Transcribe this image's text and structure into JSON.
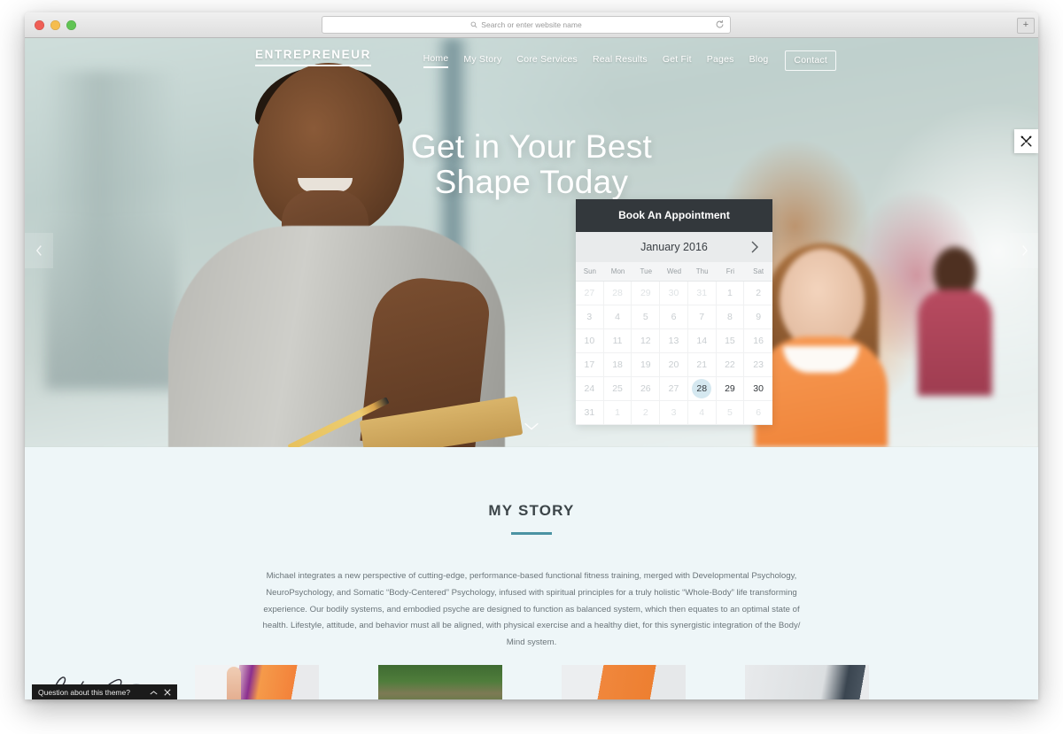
{
  "browser": {
    "address_placeholder": "Search or enter website name",
    "search_icon": "search-icon",
    "reload_icon": "reload-icon",
    "new_tab_label": "+",
    "traffic_lights": [
      "close",
      "minimize",
      "maximize"
    ]
  },
  "site": {
    "brand": "ENTREPRENEUR",
    "nav": [
      {
        "label": "Home",
        "active": true,
        "boxed": false
      },
      {
        "label": "My Story",
        "active": false,
        "boxed": false
      },
      {
        "label": "Core Services",
        "active": false,
        "boxed": false
      },
      {
        "label": "Real Results",
        "active": false,
        "boxed": false
      },
      {
        "label": "Get Fit",
        "active": false,
        "boxed": false
      },
      {
        "label": "Pages",
        "active": false,
        "boxed": false
      },
      {
        "label": "Blog",
        "active": false,
        "boxed": false
      },
      {
        "label": "Contact",
        "active": false,
        "boxed": true
      }
    ]
  },
  "hero": {
    "headline_line1": "Get in Your Best",
    "headline_line2": "Shape Today",
    "prev_arrow_icon": "chevron-left-icon",
    "next_arrow_icon": "chevron-right-icon",
    "scroll_icon": "chevron-down-icon"
  },
  "appointment": {
    "title": "Book An Appointment",
    "month": "January 2016",
    "next_month_icon": "chevron-right-icon",
    "weekdays": [
      "Sun",
      "Mon",
      "Tue",
      "Wed",
      "Thu",
      "Fri",
      "Sat"
    ],
    "selected_day": "28",
    "highlight_color": "#d5e8f0",
    "header_color": "#33383c",
    "weeks": [
      [
        {
          "d": "27",
          "state": "out"
        },
        {
          "d": "28",
          "state": "out"
        },
        {
          "d": "29",
          "state": "out"
        },
        {
          "d": "30",
          "state": "out"
        },
        {
          "d": "31",
          "state": "out"
        },
        {
          "d": "1",
          "state": "past"
        },
        {
          "d": "2",
          "state": "past"
        }
      ],
      [
        {
          "d": "3",
          "state": "past"
        },
        {
          "d": "4",
          "state": "past"
        },
        {
          "d": "5",
          "state": "past"
        },
        {
          "d": "6",
          "state": "past"
        },
        {
          "d": "7",
          "state": "past"
        },
        {
          "d": "8",
          "state": "past"
        },
        {
          "d": "9",
          "state": "past"
        }
      ],
      [
        {
          "d": "10",
          "state": "past"
        },
        {
          "d": "11",
          "state": "past"
        },
        {
          "d": "12",
          "state": "past"
        },
        {
          "d": "13",
          "state": "past"
        },
        {
          "d": "14",
          "state": "past"
        },
        {
          "d": "15",
          "state": "past"
        },
        {
          "d": "16",
          "state": "past"
        }
      ],
      [
        {
          "d": "17",
          "state": "past"
        },
        {
          "d": "18",
          "state": "past"
        },
        {
          "d": "19",
          "state": "past"
        },
        {
          "d": "20",
          "state": "past"
        },
        {
          "d": "21",
          "state": "past"
        },
        {
          "d": "22",
          "state": "past"
        },
        {
          "d": "23",
          "state": "past"
        }
      ],
      [
        {
          "d": "24",
          "state": "past"
        },
        {
          "d": "25",
          "state": "past"
        },
        {
          "d": "26",
          "state": "past"
        },
        {
          "d": "27",
          "state": "past"
        },
        {
          "d": "28",
          "state": "selected"
        },
        {
          "d": "29",
          "state": "avail"
        },
        {
          "d": "30",
          "state": "avail"
        }
      ],
      [
        {
          "d": "31",
          "state": "past"
        },
        {
          "d": "1",
          "state": "out"
        },
        {
          "d": "2",
          "state": "out"
        },
        {
          "d": "3",
          "state": "out"
        },
        {
          "d": "4",
          "state": "out"
        },
        {
          "d": "5",
          "state": "out"
        },
        {
          "d": "6",
          "state": "out"
        }
      ]
    ]
  },
  "story": {
    "title": "MY STORY",
    "accent_color": "#4b93a3",
    "body": "Michael integrates a new perspective of cutting-edge, performance-based functional fitness training, merged with Developmental Psychology, NeuroPsychology, and Somatic “Body-Centered” Psychology, infused with spiritual principles for a truly holistic “Whole-Body” life transforming experience. Our bodily systems, and embodied psyche are designed to function as balanced system, which then equates to an optimal state of health. Lifestyle, attitude, and behavior must all be aligned, with physical exercise and a healthy diet, for this synergistic integration of the Body/ Mind system.",
    "signature_alt": "signature"
  },
  "theme_tools": {
    "icon": "tools-icon"
  },
  "chat": {
    "label": "Question about this theme?",
    "collapse_icon": "chevron-up-icon",
    "close_icon": "close-icon"
  }
}
